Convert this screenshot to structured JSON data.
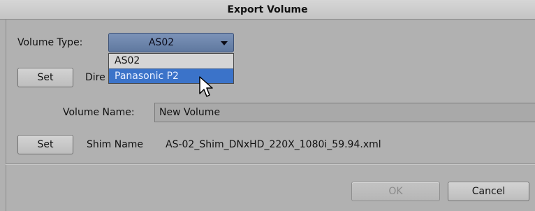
{
  "dialog": {
    "title": "Export Volume"
  },
  "volume_type": {
    "label": "Volume Type:",
    "selected": "AS02",
    "options": [
      "AS02",
      "Panasonic P2"
    ],
    "highlighted": "Panasonic P2"
  },
  "directory": {
    "set_label": "Set",
    "label_partial": "Dire"
  },
  "volume_name": {
    "label": "Volume Name:",
    "value": "New Volume"
  },
  "shim": {
    "set_label": "Set",
    "label": "Shim Name",
    "value": "AS-02_Shim_DNxHD_220X_1080i_59.94.xml"
  },
  "buttons": {
    "ok": "OK",
    "cancel": "Cancel"
  },
  "colors": {
    "select_accent": "#6b82a9",
    "highlight": "#3b73c9"
  },
  "icons": {
    "cursor": "mouse-pointer-icon",
    "caret": "chevron-down-icon"
  }
}
